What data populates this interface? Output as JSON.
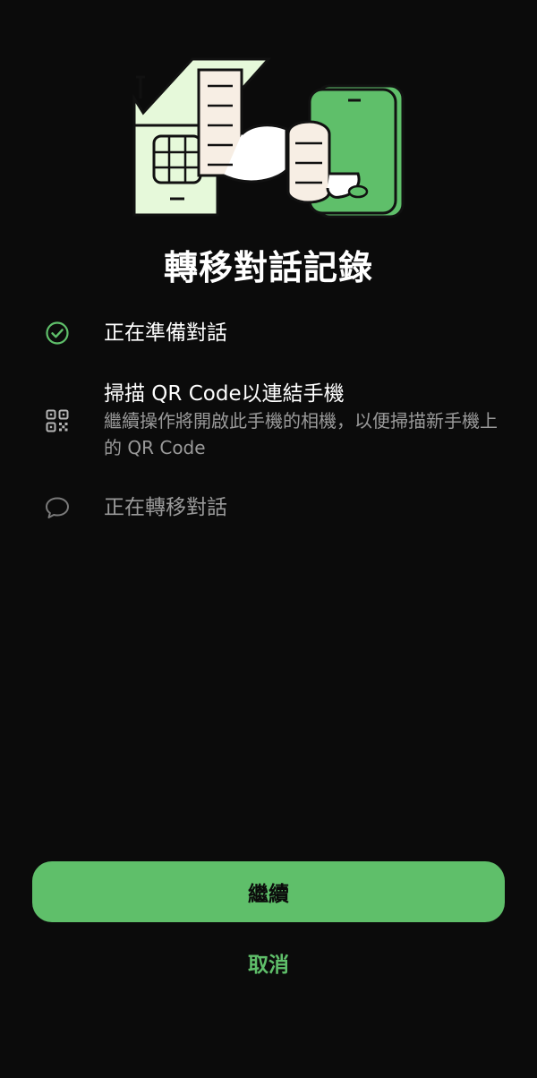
{
  "header": {
    "title": "轉移對話記錄"
  },
  "steps": [
    {
      "title": "正在準備對話",
      "icon": "check-circle-icon",
      "status": "done"
    },
    {
      "title": "掃描 QR Code以連結手機",
      "description": "繼續操作將開啟此手機的相機，以便掃描新手機上的 QR Code",
      "icon": "qr-code-icon",
      "status": "current"
    },
    {
      "title": "正在轉移對話",
      "icon": "chat-bubble-icon",
      "status": "pending"
    }
  ],
  "actions": {
    "continue_label": "繼續",
    "cancel_label": "取消"
  },
  "colors": {
    "background": "#0b0b0b",
    "accent": "#5fbf6a",
    "muted_text": "#9a9a9a",
    "illustration_light_green": "#e6f9da",
    "illustration_paper": "#f7eee4"
  }
}
